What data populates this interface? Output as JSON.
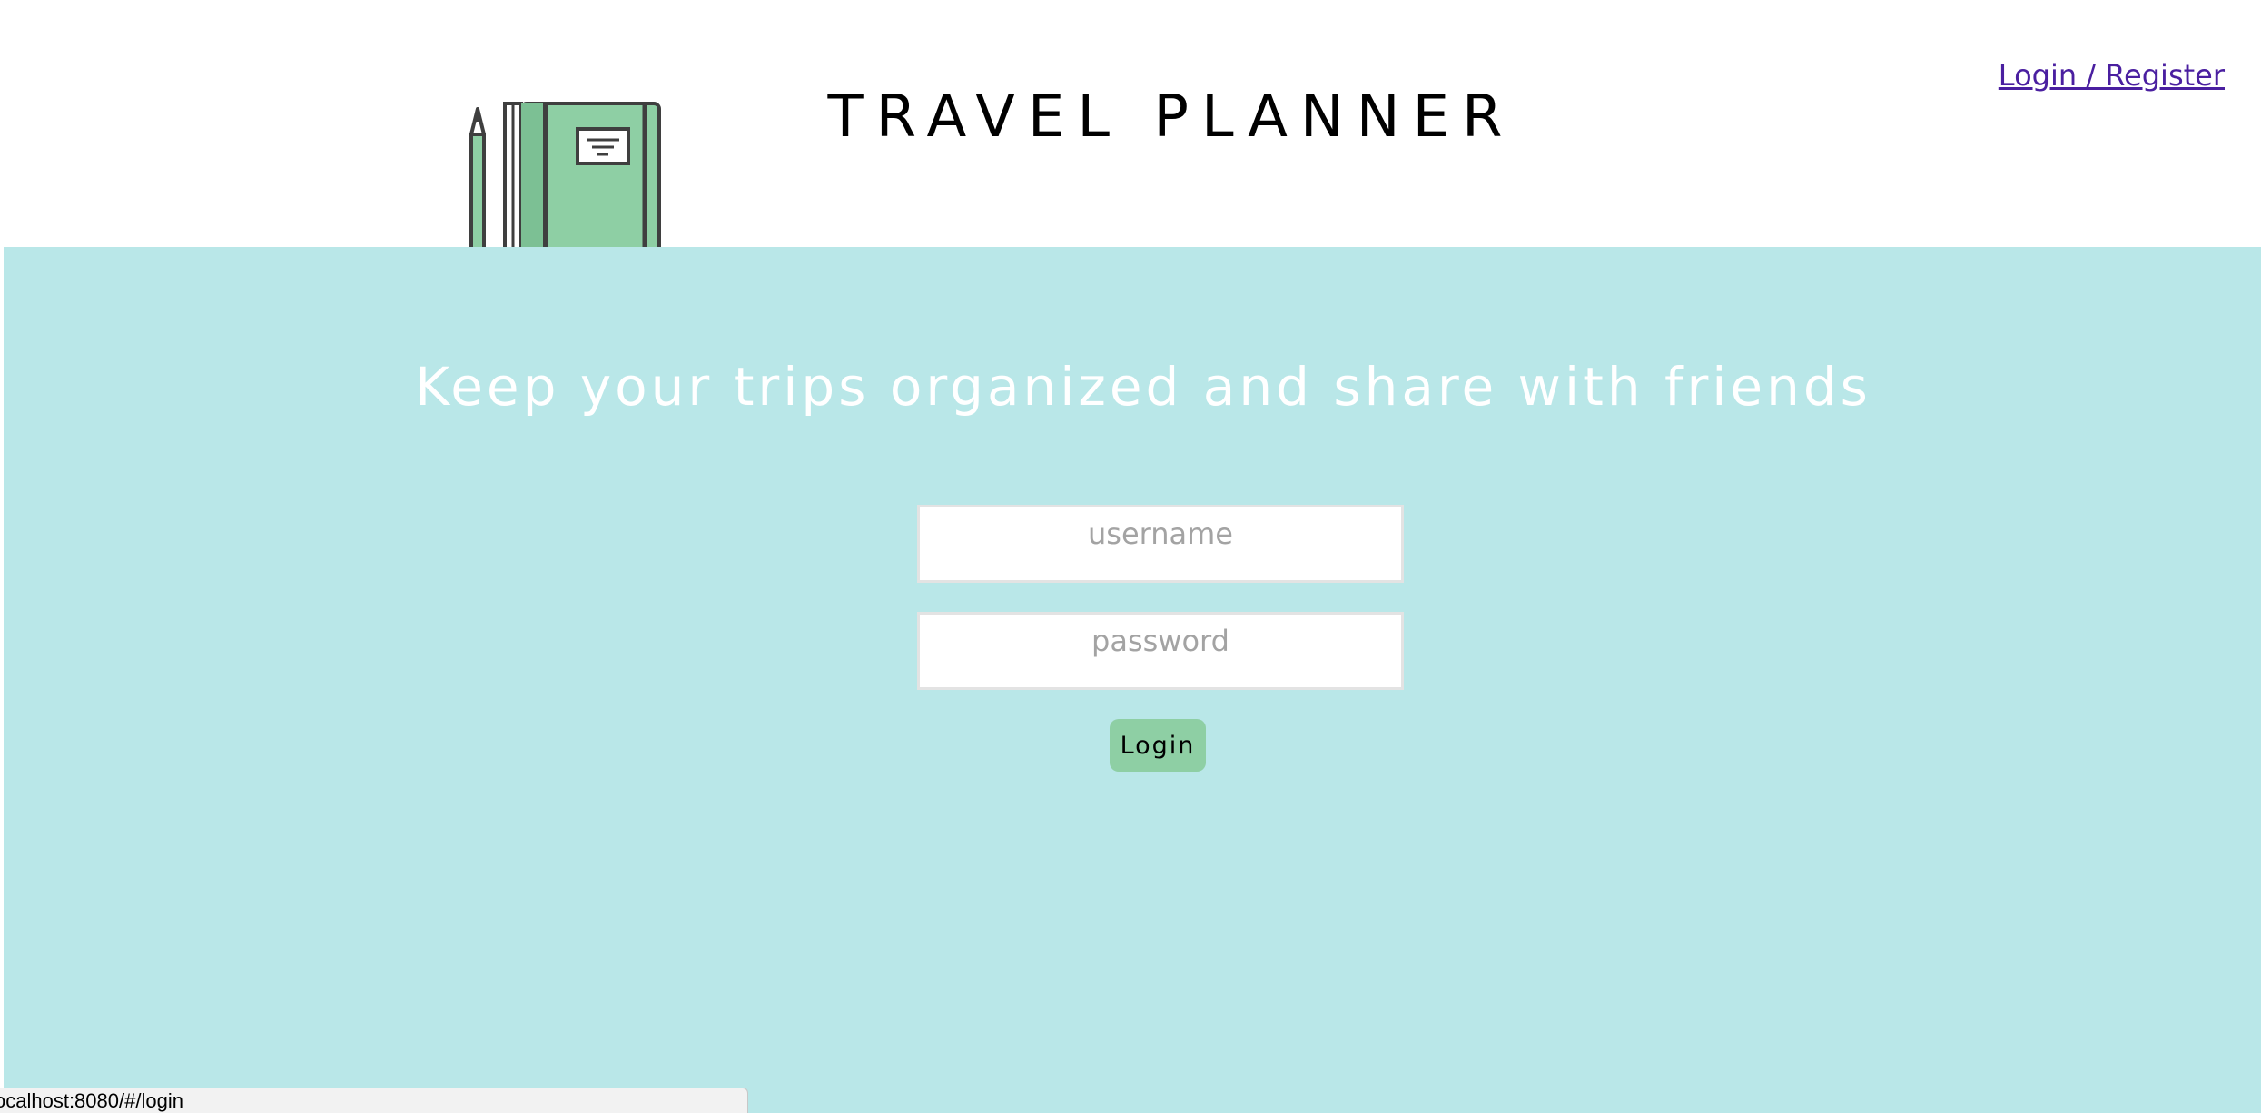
{
  "header": {
    "site_title": "TRAVEL PLANNER",
    "nav_login_label": "Login / Register",
    "logo_icon": "notebook-and-pencil-icon"
  },
  "hero": {
    "tagline": "Keep your trips organized and share with friends"
  },
  "login_form": {
    "username": {
      "value": "",
      "placeholder": "username"
    },
    "password": {
      "value": "",
      "placeholder": "password"
    },
    "submit_label": "Login"
  },
  "status_bar": {
    "url": "ocalhost:8080/#/login"
  },
  "colors": {
    "hero_background": "#b9e7e8",
    "button_background": "#8ecfa4",
    "link": "#4a1fa0",
    "notebook_green": "#8ecfa4",
    "notebook_outline": "#3f3f3f"
  }
}
